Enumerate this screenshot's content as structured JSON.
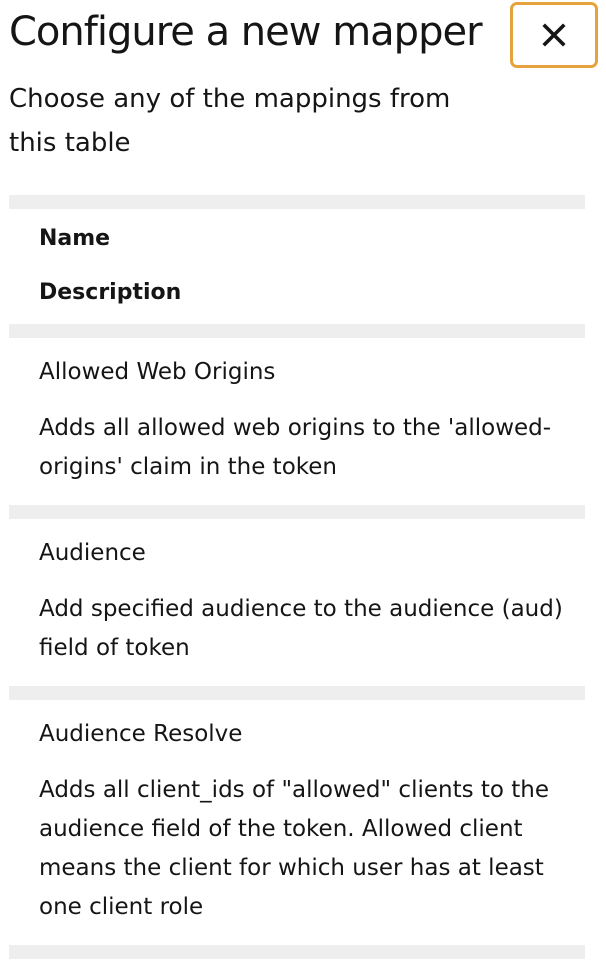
{
  "modal": {
    "title": "Configure a new mapper",
    "subtitle": "Choose any of the mappings from this table",
    "close_icon": "close-icon"
  },
  "table": {
    "columns": [
      "Name",
      "Description"
    ],
    "rows": [
      {
        "name": "Allowed Web Origins",
        "description": "Adds all allowed web origins to the 'allowed-origins' claim in the token"
      },
      {
        "name": "Audience",
        "description": "Add specified audience to the audience (aud) field of token"
      },
      {
        "name": "Audience Resolve",
        "description": "Adds all client_ids of \"allowed\" clients to the audience field of the token. Allowed client means the client for which user has at least one client role"
      }
    ]
  },
  "colors": {
    "focus_ring": "#e6a23c",
    "separator": "#eeeeee",
    "text": "#151515"
  }
}
